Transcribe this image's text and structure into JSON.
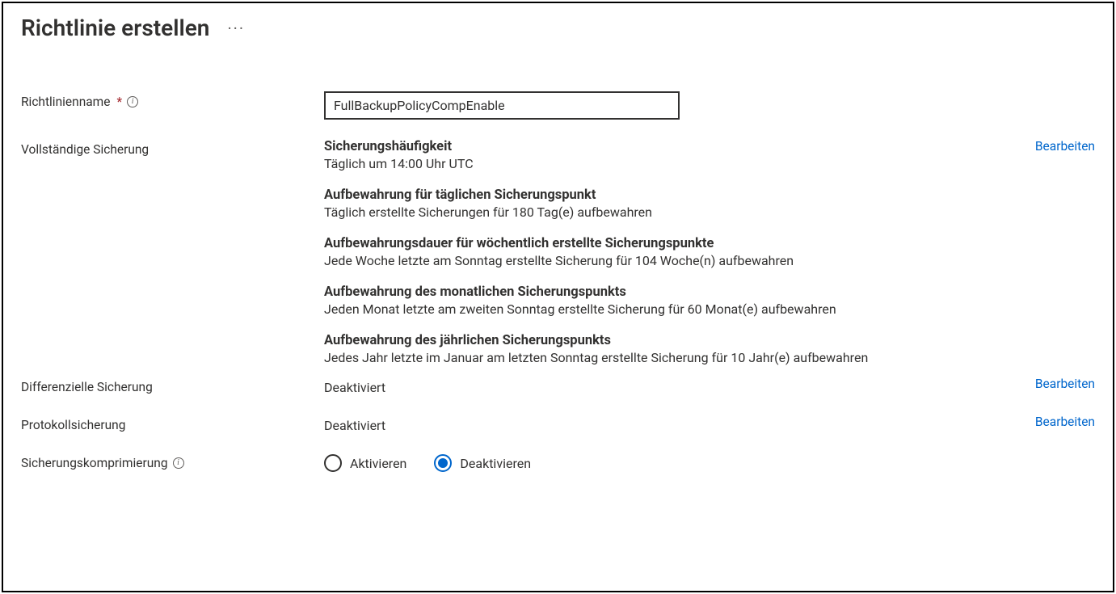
{
  "title": "Richtlinie erstellen",
  "policy_name": {
    "label": "Richtlinienname",
    "value": "FullBackupPolicyCompEnable"
  },
  "full_backup": {
    "label": "Vollständige Sicherung",
    "edit": "Bearbeiten",
    "items": [
      {
        "heading": "Sicherungshäufigkeit",
        "text": "Täglich um 14:00 Uhr UTC"
      },
      {
        "heading": "Aufbewahrung für täglichen Sicherungspunkt",
        "text": "Täglich erstellte Sicherungen für 180 Tag(e) aufbewahren"
      },
      {
        "heading": "Aufbewahrungsdauer für wöchentlich erstellte Sicherungspunkte",
        "text": "Jede Woche letzte am Sonntag erstellte Sicherung für 104 Woche(n) aufbewahren"
      },
      {
        "heading": "Aufbewahrung des monatlichen Sicherungspunkts",
        "text": "Jeden Monat letzte am zweiten Sonntag erstellte Sicherung für 60 Monat(e) aufbewahren"
      },
      {
        "heading": "Aufbewahrung des jährlichen Sicherungspunkts",
        "text": "Jedes Jahr letzte im Januar am letzten Sonntag erstellte Sicherung für 10 Jahr(e) aufbewahren"
      }
    ]
  },
  "differential_backup": {
    "label": "Differenzielle Sicherung",
    "value": "Deaktiviert",
    "edit": "Bearbeiten"
  },
  "log_backup": {
    "label": "Protokollsicherung",
    "value": "Deaktiviert",
    "edit": "Bearbeiten"
  },
  "compression": {
    "label": "Sicherungskomprimierung",
    "options": {
      "enable": "Aktivieren",
      "disable": "Deaktivieren"
    },
    "selected": "disable"
  }
}
